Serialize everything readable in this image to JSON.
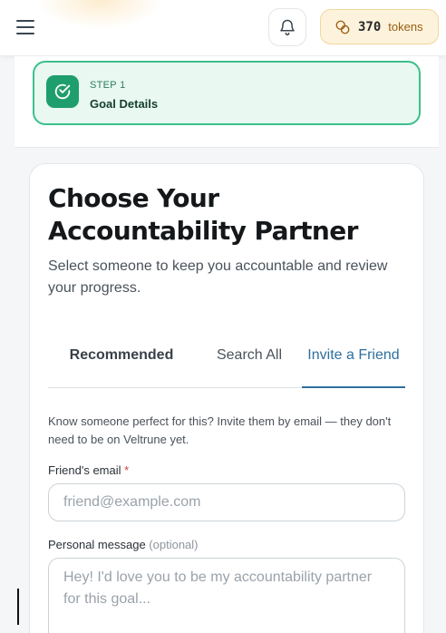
{
  "header": {
    "menu_icon": "hamburger-menu-icon",
    "bell_icon": "bell-icon",
    "tokens": {
      "icon": "coins-icon",
      "count": "370",
      "label": "tokens"
    }
  },
  "step": {
    "icon": "check-circle-icon",
    "kicker": "STEP 1",
    "title": "Goal Details"
  },
  "main": {
    "title": "Choose Your Accountability Partner",
    "subtitle": "Select someone to keep you accountable and review your progress.",
    "tabs": [
      {
        "label": "Recommended"
      },
      {
        "label": "Search All"
      },
      {
        "label": "Invite a Friend"
      }
    ],
    "active_tab": "Invite a Friend",
    "invite_help": "Know someone perfect for this? Invite them by email — they don't need to be on Veltrune yet.",
    "email_label": "Friend's email",
    "email_required_mark": "*",
    "email_placeholder": "friend@example.com",
    "message_label": "Personal message",
    "message_optional": "(optional)",
    "message_placeholder": "Hey! I'd love you to be my accountability partner for this goal..."
  },
  "colors": {
    "accent_green": "#1e9e6c",
    "active_tab_blue": "#2f6f9d",
    "tokens_bg": "#fdf3dc",
    "required_red": "#d23c3c"
  }
}
